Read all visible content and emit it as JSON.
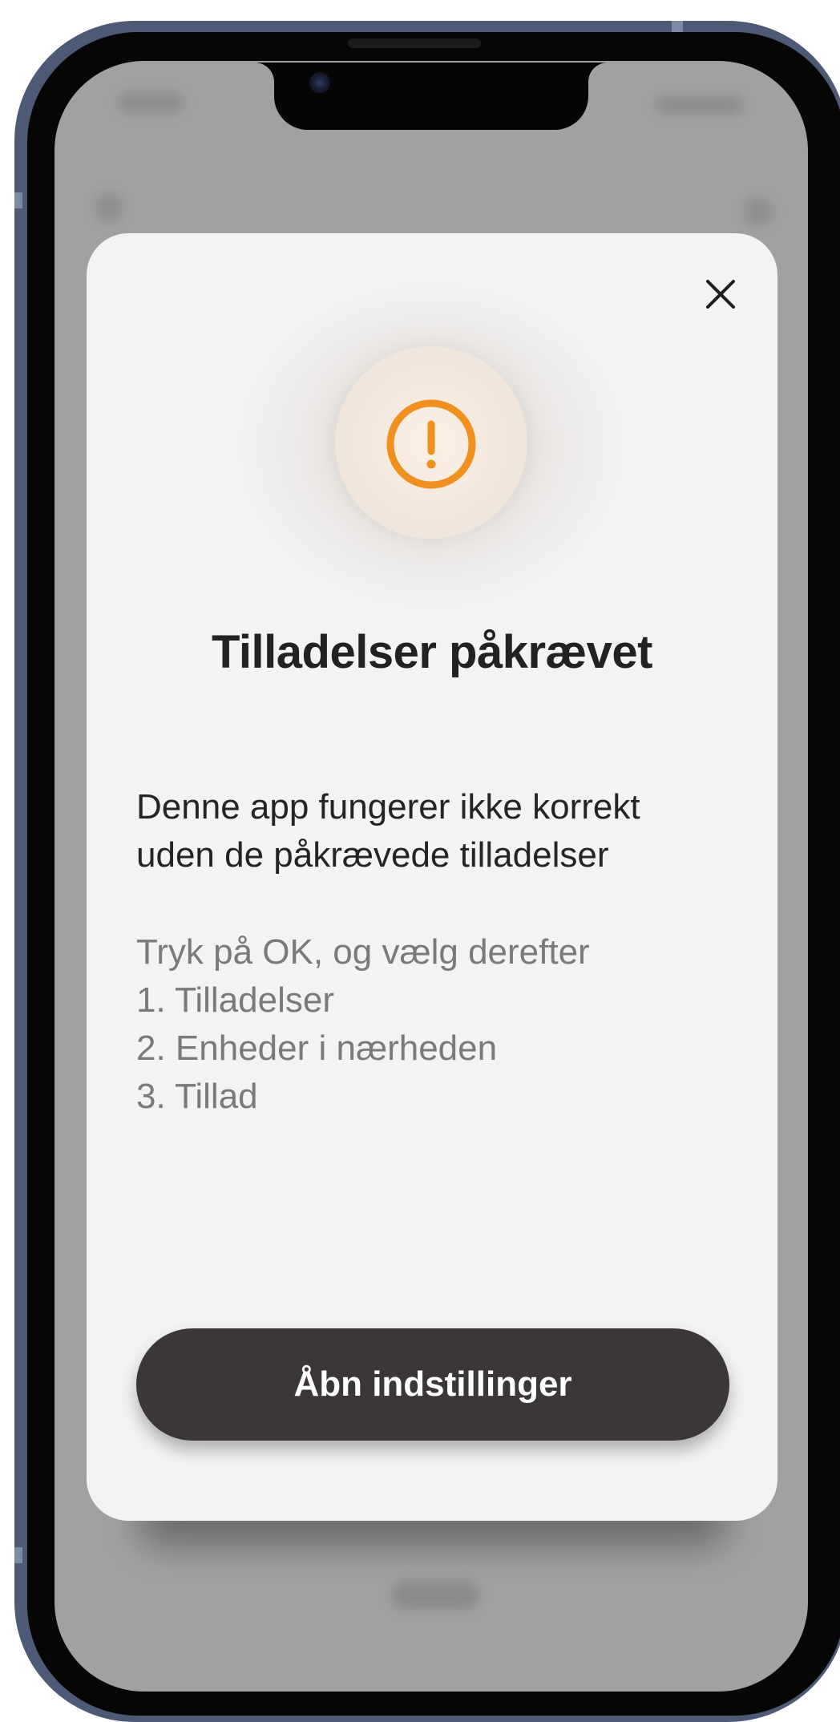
{
  "dialog": {
    "title": "Tilladelser påkrævet",
    "description_line1": "Denne app fungerer ikke korrekt",
    "description_line2": "uden de påkrævede tilladelser",
    "instructions": [
      "Tryk på OK, og vælg derefter",
      "1. Tilladelser",
      "2. Enheder i nærheden",
      "3. Tillad"
    ],
    "action_button_label": "Åbn indstillinger",
    "close_icon": "close-icon",
    "status_icon": "warning-circle-icon"
  },
  "colors": {
    "accent": "#f0901e",
    "button_bg": "#3b3737",
    "modal_bg": "#f3f3f3",
    "frame": "#4c5a76"
  }
}
